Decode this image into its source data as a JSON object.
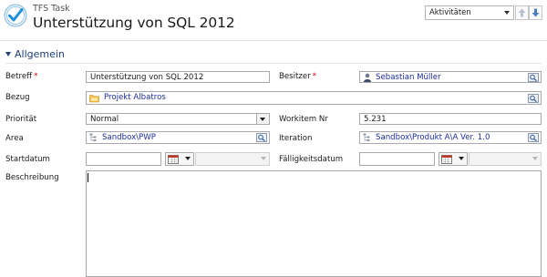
{
  "header": {
    "entity_type": "TFS Task",
    "record_title": "Unterstützung von SQL 2012",
    "nav_view": "Aktivitäten",
    "logo_icon": "checkmark-circle-icon",
    "up_icon": "arrow-up-icon",
    "down_icon": "arrow-down-icon"
  },
  "section": {
    "title": "Allgemein"
  },
  "form": {
    "betreff": {
      "label": "Betreff",
      "required_mark": "*",
      "value": "Unterstützung von SQL 2012"
    },
    "besitzer": {
      "label": "Besitzer",
      "required_mark": "*",
      "value": "Sebastian Müller",
      "icon": "user-icon"
    },
    "bezug": {
      "label": "Bezug",
      "value": "Projekt Albatros",
      "icon": "folder-icon"
    },
    "prioritaet": {
      "label": "Priorität",
      "value": "Normal"
    },
    "workitem": {
      "label": "Workitem Nr",
      "value": "5.231"
    },
    "area": {
      "label": "Area",
      "value": "Sandbox\\PWP",
      "icon": "tree-icon"
    },
    "iteration": {
      "label": "Iteration",
      "value": "Sandbox\\Produkt A\\A Ver. 1.0",
      "icon": "tree-icon"
    },
    "startdatum": {
      "label": "Startdatum",
      "value": ""
    },
    "faelligkeitsdatum": {
      "label": "Fälligkeitsdatum",
      "value": ""
    },
    "beschreibung": {
      "label": "Beschreibung",
      "value": ""
    }
  },
  "colors": {
    "link": "#1d2d97",
    "section": "#1d3f7a",
    "required": "#d10000",
    "logo": "#1f8fd8"
  }
}
